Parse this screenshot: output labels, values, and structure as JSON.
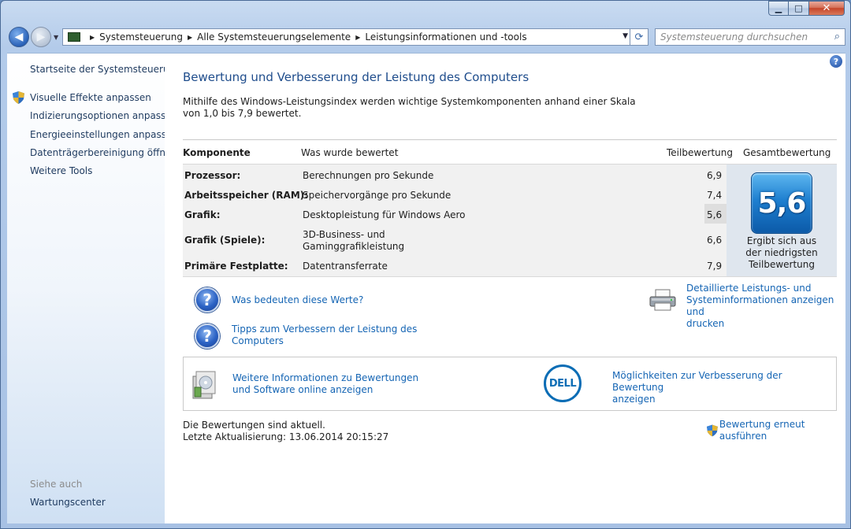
{
  "window": {
    "buttons": {
      "minimize": "▁",
      "maximize": "□",
      "close": "✕"
    }
  },
  "navigation": {
    "breadcrumb": [
      "Systemsteuerung",
      "Alle Systemsteuerungselemente",
      "Leistungsinformationen und -tools"
    ],
    "search_placeholder": "Systemsteuerung durchsuchen"
  },
  "sidebar": {
    "home": "Startseite der Systemsteuerung",
    "items": [
      {
        "label": "Visuelle Effekte anpassen",
        "icon": "uac-shield-icon"
      },
      {
        "label": "Indizierungsoptionen anpassen"
      },
      {
        "label": "Energieeinstellungen anpassen"
      },
      {
        "label": "Datenträgerbereinigung öffnen"
      },
      {
        "label": "Weitere Tools"
      }
    ],
    "see_also_heading": "Siehe auch",
    "see_also": [
      "Wartungscenter"
    ]
  },
  "main": {
    "title": "Bewertung und Verbesserung der Leistung des Computers",
    "intro": "Mithilfe des Windows-Leistungsindex werden wichtige Systemkomponenten anhand einer Skala von 1,0 bis 7,9 bewertet.",
    "table": {
      "headers": {
        "component": "Komponente",
        "rated": "Was wurde bewertet",
        "subscore": "Teilbewertung",
        "total": "Gesamtbewertung"
      },
      "rows": [
        {
          "component": "Prozessor:",
          "rated": "Berechnungen pro Sekunde",
          "score": "6,9"
        },
        {
          "component": "Arbeitsspeicher (RAM):",
          "rated": "Speichervorgänge pro Sekunde",
          "score": "7,4"
        },
        {
          "component": "Grafik:",
          "rated": "Desktopleistung für Windows Aero",
          "score": "5,6"
        },
        {
          "component": "Grafik (Spiele):",
          "rated": "3D-Business- und Gaminggrafikleistung",
          "rated_line1": "3D-Business- und",
          "rated_line2": "Gaminggrafikleistung",
          "score": "6,6"
        },
        {
          "component": "Primäre Festplatte:",
          "rated": "Datentransferrate",
          "score": "7,9"
        }
      ],
      "base_score": "5,6",
      "base_note": "Ergibt sich aus der niedrigsten Teilbewertung",
      "base_note_lines": [
        "Ergibt sich aus",
        "der niedrigsten",
        "Teilbewertung"
      ]
    },
    "links": {
      "what_mean": "Was bedeuten diese Werte?",
      "tips_line1": "Tipps zum Verbessern der Leistung des",
      "tips_line2": "Computers",
      "details_line1": "Detaillierte Leistungs- und",
      "details_line2": "Systeminformationen anzeigen und",
      "details_line3": "drucken",
      "more_info_line1": "Weitere Informationen zu Bewertungen",
      "more_info_line2": "und Software online anzeigen",
      "dell_line1": "Möglichkeiten zur Verbesserung der Bewertung",
      "dell_line2": "anzeigen",
      "rerun": "Bewertung erneut ausführen"
    },
    "dell_logo": "DELL",
    "status_line1": "Die Bewertungen sind aktuell.",
    "status_line2": "Letzte Aktualisierung: 13.06.2014 20:15:27"
  },
  "colors": {
    "link": "#1565b4",
    "title": "#1f4d8c",
    "badge": "#1e7fd0"
  }
}
